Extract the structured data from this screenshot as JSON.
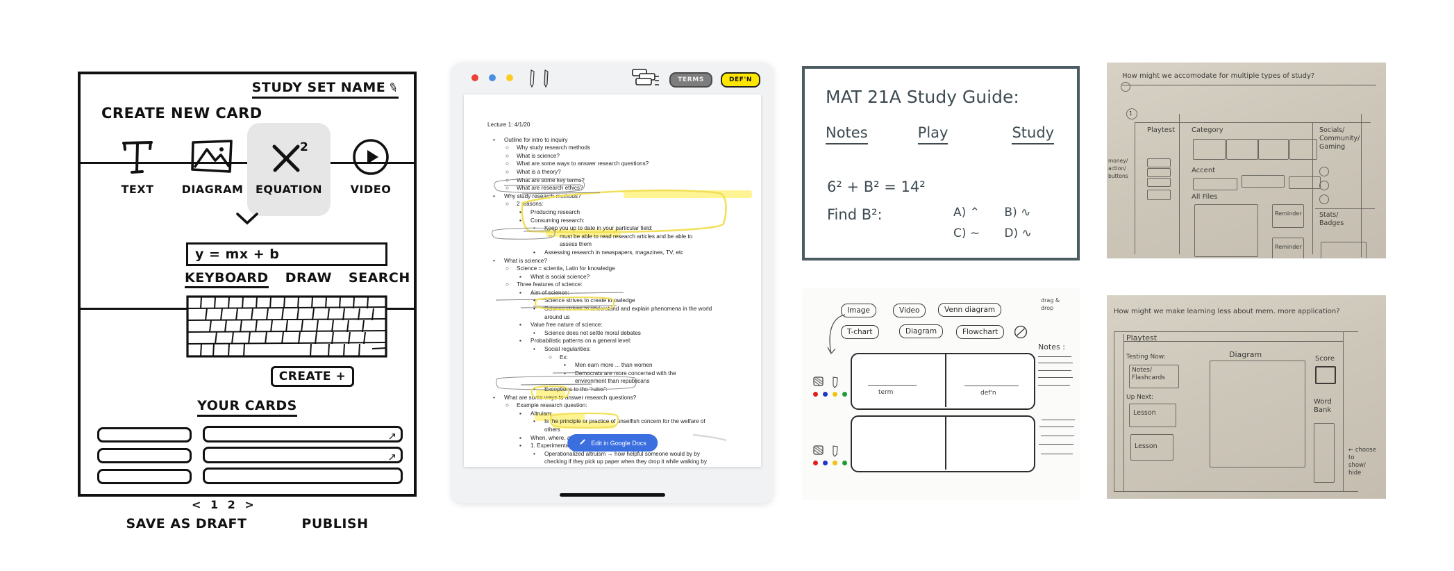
{
  "wireframe": {
    "set_name": "STUDY SET NAME",
    "edit_icon": "pencil-icon",
    "create_new_card": "CREATE NEW CARD",
    "card_types": [
      {
        "label": "TEXT",
        "icon": "text-icon",
        "selected": false
      },
      {
        "label": "DIAGRAM",
        "icon": "image-icon",
        "selected": false
      },
      {
        "label": "EQUATION",
        "icon": "equation-icon",
        "selected": true
      },
      {
        "label": "VIDEO",
        "icon": "play-icon",
        "selected": false
      }
    ],
    "expand_chevron": "chevron-down-icon",
    "equation_value": "y = mx + b",
    "input_modes": [
      {
        "label": "KEYBOARD",
        "selected": true
      },
      {
        "label": "DRAW",
        "selected": false
      },
      {
        "label": "SEARCH",
        "selected": false
      }
    ],
    "keyboard_icon": "keyboard-icon",
    "create_button": "CREATE +",
    "your_cards": "YOUR CARDS",
    "cards": [
      {
        "side": "left",
        "expand": false
      },
      {
        "side": "right",
        "expand": true
      },
      {
        "side": "left",
        "expand": false
      },
      {
        "side": "right",
        "expand": true
      },
      {
        "side": "left",
        "expand": false
      },
      {
        "side": "right",
        "expand": false
      }
    ],
    "pager": "< 1  2 >",
    "save_draft": "SAVE AS DRAFT",
    "publish": "PUBLISH"
  },
  "tablet": {
    "window_dots": [
      "#ea4335",
      "#4a90e2",
      "#fbcd21"
    ],
    "tools": [
      "pen-icon",
      "pencil-icon"
    ],
    "cards_icon": "stacked-cards-icon",
    "chip_terms": "TERMS",
    "chip_defn": "DEF'N",
    "doc_header": "Lecture 1: 4/1/20",
    "doc_lines": [
      {
        "lvl": 1,
        "bullet": "•",
        "text": "Outline for intro to inquiry"
      },
      {
        "lvl": 2,
        "bullet": "○",
        "text": "Why study research methods"
      },
      {
        "lvl": 2,
        "bullet": "○",
        "text": "What is science?"
      },
      {
        "lvl": 2,
        "bullet": "○",
        "text": "What are some ways to answer research questions?"
      },
      {
        "lvl": 2,
        "bullet": "○",
        "text": "What is a theory?"
      },
      {
        "lvl": 2,
        "bullet": "○",
        "text": "What are some key terms?"
      },
      {
        "lvl": 2,
        "bullet": "○",
        "text": "What are research ethics?"
      },
      {
        "lvl": 1,
        "bullet": "•",
        "text": "Why study research methods?"
      },
      {
        "lvl": 2,
        "bullet": "○",
        "text": "2 reasons:"
      },
      {
        "lvl": 3,
        "bullet": "▪",
        "text": "Producing research"
      },
      {
        "lvl": 3,
        "bullet": "▪",
        "text": "Consuming research:"
      },
      {
        "lvl": 4,
        "bullet": "•",
        "text": "Keep you up to date in your particular field:"
      },
      {
        "lvl": 5,
        "bullet": "○",
        "text": "must be able to read research articles and be able to"
      },
      {
        "lvl": 5,
        "bullet": "",
        "text": "assess them"
      },
      {
        "lvl": 4,
        "bullet": "•",
        "text": "Assessing research in newspapers, magazines, TV, etc"
      },
      {
        "lvl": 1,
        "bullet": "•",
        "text": "What is science?"
      },
      {
        "lvl": 2,
        "bullet": "○",
        "text": "Science = scientia, Latin for knowledge"
      },
      {
        "lvl": 3,
        "bullet": "▪",
        "text": "What is social science?"
      },
      {
        "lvl": 2,
        "bullet": "○",
        "text": "Three features of science:"
      },
      {
        "lvl": 3,
        "bullet": "▪",
        "text": "Aim of science:"
      },
      {
        "lvl": 4,
        "bullet": "•",
        "text": "Science strives to create knowledge"
      },
      {
        "lvl": 4,
        "bullet": "•",
        "text": "Science strives to understand and explain phenomena in the world"
      },
      {
        "lvl": 4,
        "bullet": "",
        "text": "around us"
      },
      {
        "lvl": 3,
        "bullet": "▪",
        "text": "Value free nature of science:"
      },
      {
        "lvl": 4,
        "bullet": "•",
        "text": "Science does not settle moral debates"
      },
      {
        "lvl": 3,
        "bullet": "▪",
        "text": "Probabilistic patterns on a general level:"
      },
      {
        "lvl": 4,
        "bullet": "•",
        "text": "Social regularities:"
      },
      {
        "lvl": 5,
        "bullet": "○",
        "text": "Ex:"
      },
      {
        "lvl": 6,
        "bullet": "▪",
        "text": "Men earn more ... than women"
      },
      {
        "lvl": 6,
        "bullet": "▪",
        "text": "Democrats are more concerned with the"
      },
      {
        "lvl": 6,
        "bullet": "",
        "text": "environment than republicans"
      },
      {
        "lvl": 4,
        "bullet": "•",
        "text": "Exceptions to the “rules”:"
      },
      {
        "lvl": 1,
        "bullet": "•",
        "text": "What are some ways to answer research questions?"
      },
      {
        "lvl": 2,
        "bullet": "○",
        "text": "Example research question:"
      },
      {
        "lvl": 3,
        "bullet": "▪",
        "text": "Altruism:"
      },
      {
        "lvl": 4,
        "bullet": "•",
        "text": "Is the principle or practice of unselfish concern for the welfare of"
      },
      {
        "lvl": 4,
        "bullet": "",
        "text": "others"
      },
      {
        "lvl": 3,
        "bullet": "▪",
        "text": "When, where, and how does altruism occur?"
      },
      {
        "lvl": 3,
        "bullet": "▪",
        "text": "1. Experimentaions"
      },
      {
        "lvl": 4,
        "bullet": "•",
        "text": "Operationalized altruism → how helpful someone would by by"
      },
      {
        "lvl": 4,
        "bullet": "",
        "text": "checking if they pick up paper when they drop it while walking by"
      }
    ],
    "edit_button": "Edit in Google Docs",
    "edit_icon": "pencil-icon"
  },
  "guide": {
    "title": "MAT 21A  Study  Guide:",
    "tabs": [
      {
        "label": "Notes",
        "highlighted": false
      },
      {
        "label": "Play",
        "highlighted": false
      },
      {
        "label": "Study",
        "highlighted": true
      }
    ],
    "equation_line1": "6² + B² = 14²",
    "equation_line2": "Find  B²:",
    "answers": [
      "A) ⌃",
      "B) ∿",
      "C) ∼",
      "D) ∿"
    ],
    "border_color": "#4b5c63",
    "highlight_color": "#f5dd7e"
  },
  "sketch": {
    "chips_row1": [
      "Image",
      "Video",
      "Venn diagram"
    ],
    "chips_row2": [
      "T-chart",
      "Diagram",
      "Flowchart"
    ],
    "no_symbol": "no-entry-icon",
    "drag_drop_note": "drag &\ndrop",
    "notes_label": "Notes :",
    "card_front_label": "term",
    "card_back_label": "def'n",
    "tool_icons": [
      "eraser-icon",
      "pencil-icon"
    ],
    "color_dots": [
      "#e02020",
      "#2035c9",
      "#f0c414",
      "#1f9d35"
    ]
  },
  "photo_top": {
    "question": "How might we accomodate for multiple types of study?",
    "margin_note": "money/\naction/\nbuttons",
    "labels": [
      "Playtest",
      "Category",
      "Accent",
      "All Files",
      "Socials/\nCommunity/\nGaming",
      "Stats/\nBadges",
      "Reminder",
      "Reminder"
    ],
    "step_marker": "1"
  },
  "photo_bottom": {
    "question": "How might we make learning less about mem. more application?",
    "labels": [
      "Playtest",
      "Testing Now:",
      "Notes/\nFlashcards",
      "Up Next:",
      "Lesson",
      "Lesson",
      "Diagram",
      "Score",
      "Word\nBank"
    ],
    "side_note": "← choose\n     to\n  show/\n   hide"
  }
}
